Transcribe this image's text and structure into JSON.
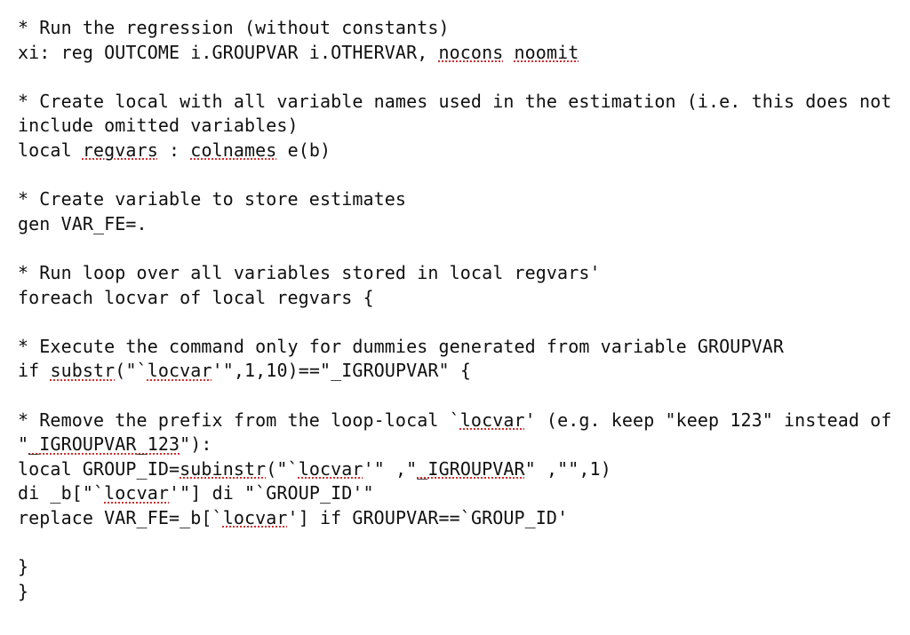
{
  "code": {
    "l01a": "* Run the regression (without constants)",
    "l02_pre": "xi: reg OUTCOME i.GROUPVAR i.OTHERVAR, ",
    "l02_sp1": "nocons",
    "l02_mid": " ",
    "l02_sp2": "noomit",
    "blank1": "",
    "l03a": "* Create local with all variable names used in the estimation (i.e. this does not include omitted variables)",
    "l04_pre": "local ",
    "l04_sp1": "regvars",
    "l04_mid": " : ",
    "l04_sp2": "colnames",
    "l04_post": " e(b)",
    "blank2": "",
    "l05a": "* Create variable to store estimates",
    "l06a": "gen VAR_FE=.",
    "blank3": "",
    "l07a": "* Run loop over all variables stored in local regvars'",
    "l08a": "foreach locvar of local regvars {",
    "blank4": "",
    "l09a": "* Execute the command only for dummies generated from variable GROUPVAR",
    "l10_pre": "if ",
    "l10_sp1": "substr",
    "l10_mid": "(\"`",
    "l10_sp2": "locvar",
    "l10_post": "'\",1,10)==\"_IGROUPVAR\" {",
    "blank5": "",
    "l11_pre": "* Remove the prefix from the loop-local `",
    "l11_sp1": "locvar",
    "l11_mid": "' (e.g. keep \"keep 123\" instead of \"",
    "l11_sp2": "_IGROUPVAR_123",
    "l11_post": "\"):",
    "l12_pre": "local GROUP_ID=",
    "l12_sp1": "subinstr",
    "l12_m1": "(\"`",
    "l12_sp2": "locvar",
    "l12_m2": "'\" ,\"",
    "l12_sp3": "_IGROUPVAR",
    "l12_post": "\" ,\"\",1)",
    "l13_pre": "di _b[\"`",
    "l13_sp1": "locvar",
    "l13_post": "'\"] di \"`GROUP_ID'\"",
    "l14_pre": "replace VAR_FE=_b[`",
    "l14_sp1": "locvar",
    "l14_post": "'] if GROUPVAR==`GROUP_ID'",
    "blank6": "",
    "l15a": "}",
    "l16a": "}"
  }
}
